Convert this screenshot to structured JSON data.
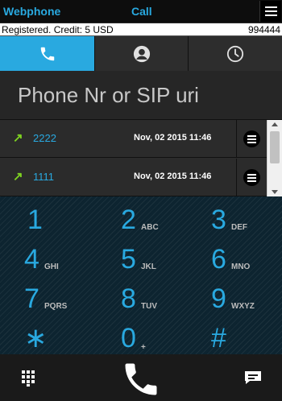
{
  "header": {
    "app_title": "Webphone",
    "call_title": "Call"
  },
  "status": {
    "text": "Registered. Credit: 5 USD",
    "number": "994444"
  },
  "tabs": [
    {
      "name": "dial",
      "icon": "phone-icon",
      "active": true
    },
    {
      "name": "contacts",
      "icon": "contact-icon",
      "active": false
    },
    {
      "name": "history",
      "icon": "clock-icon",
      "active": false
    }
  ],
  "dial_input": {
    "value": "",
    "placeholder": "Phone Nr or SIP uri"
  },
  "recent_calls": [
    {
      "direction_icon": "outgoing-arrow-icon",
      "arrow": "↗",
      "number": "2222",
      "datetime": "Nov, 02  2015  11:46"
    },
    {
      "direction_icon": "outgoing-arrow-icon",
      "arrow": "↗",
      "number": "1111",
      "datetime": "Nov, 02  2015  11:46"
    }
  ],
  "keypad": [
    {
      "digit": "1",
      "letters": ""
    },
    {
      "digit": "2",
      "letters": "ABC"
    },
    {
      "digit": "3",
      "letters": "DEF"
    },
    {
      "digit": "4",
      "letters": "GHI"
    },
    {
      "digit": "5",
      "letters": "JKL"
    },
    {
      "digit": "6",
      "letters": "MNO"
    },
    {
      "digit": "7",
      "letters": "PQRS"
    },
    {
      "digit": "8",
      "letters": "TUV"
    },
    {
      "digit": "9",
      "letters": "WXYZ"
    },
    {
      "digit": "∗",
      "letters": ""
    },
    {
      "digit": "0",
      "letters": "+"
    },
    {
      "digit": "#",
      "letters": ""
    }
  ],
  "bottom": {
    "left_icon": "keypad-grid-icon",
    "center_icon": "call-handset-icon",
    "right_icon": "message-icon"
  },
  "colors": {
    "accent": "#29a9e0",
    "outgoing_arrow": "#7ed321",
    "keypad_bg": "#0d2430"
  }
}
